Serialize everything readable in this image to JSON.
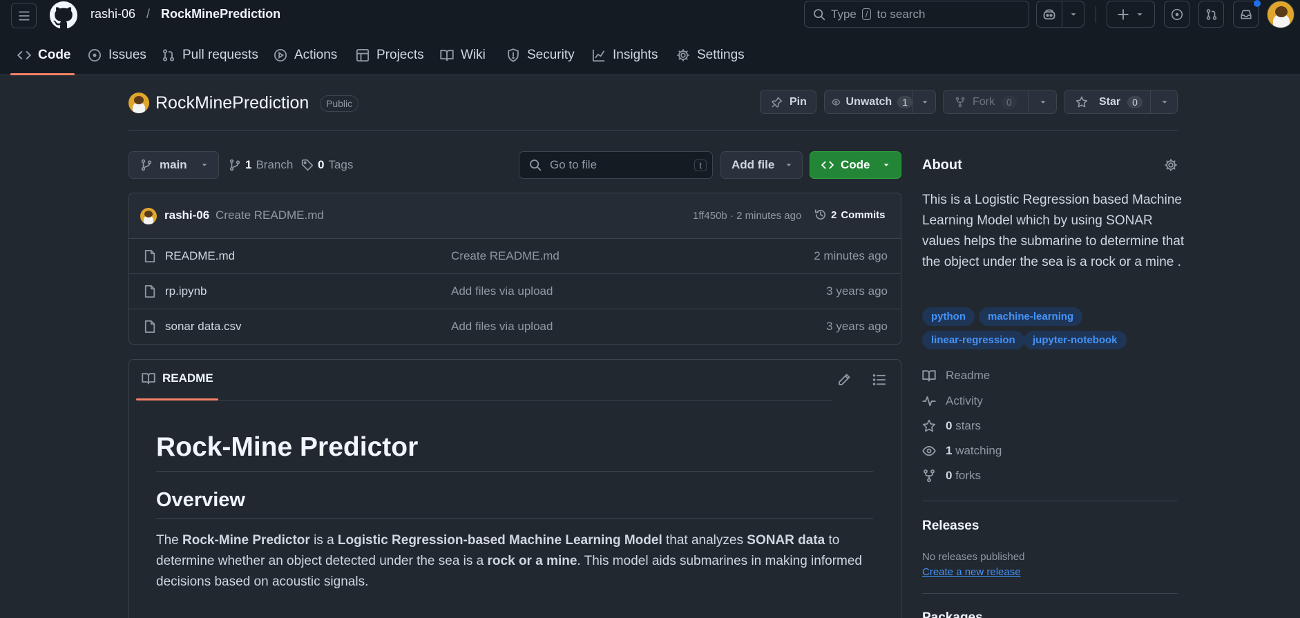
{
  "header": {
    "owner": "rashi-06",
    "separator": "/",
    "repo": "RockMinePrediction",
    "search_placeholder_parts": {
      "before": "Type",
      "key": "/",
      "after": "to search"
    }
  },
  "nav": {
    "tabs": [
      {
        "label": "Code",
        "icon": "code-icon",
        "active": true
      },
      {
        "label": "Issues",
        "icon": "issue-icon"
      },
      {
        "label": "Pull requests",
        "icon": "pull-request-icon"
      },
      {
        "label": "Actions",
        "icon": "play-icon"
      },
      {
        "label": "Projects",
        "icon": "table-icon"
      },
      {
        "label": "Wiki",
        "icon": "book-icon"
      },
      {
        "label": "Security",
        "icon": "shield-icon"
      },
      {
        "label": "Insights",
        "icon": "graph-icon"
      },
      {
        "label": "Settings",
        "icon": "gear-icon"
      }
    ]
  },
  "repo": {
    "name": "RockMinePrediction",
    "visibility": "Public",
    "pin_label": "Pin",
    "unwatch_label": "Unwatch",
    "unwatch_count": "1",
    "fork_label": "Fork",
    "fork_count": "0",
    "star_label": "Star",
    "star_count": "0"
  },
  "toolbar": {
    "branch": "main",
    "branch_count": "1",
    "branch_label": "Branch",
    "tags_count": "0",
    "tags_label": "Tags",
    "go_to_file": "Go to file",
    "go_to_file_key": "t",
    "add_file": "Add file",
    "code": "Code"
  },
  "commit": {
    "author": "rashi-06",
    "message": "Create README.md",
    "hash_time": "1ff450b · 2 minutes ago",
    "commits_count": "2",
    "commits_label": "Commits"
  },
  "files": [
    {
      "name": "README.md",
      "message": "Create README.md",
      "time": "2 minutes ago"
    },
    {
      "name": "rp.ipynb",
      "message": "Add files via upload",
      "time": "3 years ago"
    },
    {
      "name": "sonar data.csv",
      "message": "Add files via upload",
      "time": "3 years ago"
    }
  ],
  "readme": {
    "tab_label": "README",
    "title": "Rock-Mine Predictor",
    "section": "Overview",
    "para": {
      "t1": "The ",
      "b1": "Rock-Mine Predictor",
      "t2": " is a ",
      "b2": "Logistic Regression-based Machine Learning Model",
      "t3": " that analyzes ",
      "b3": "SONAR data",
      "t4": " to determine whether an object detected under the sea is a ",
      "b4": "rock or a mine",
      "t5": ". This model aids submarines in making informed decisions based on acoustic signals."
    }
  },
  "about": {
    "heading": "About",
    "description": "This is a Logistic Regression based Machine Learning Model which by using SONAR values helps the submarine to determine that the object under the sea is a rock or a mine .",
    "topics": [
      "python",
      "machine-learning",
      "linear-regression",
      "jupyter-notebook"
    ],
    "readme": "Readme",
    "activity": "Activity",
    "stars_count": "0",
    "stars_label": "stars",
    "watching_count": "1",
    "watching_label": "watching",
    "forks_count": "0",
    "forks_label": "forks"
  },
  "releases": {
    "heading": "Releases",
    "none": "No releases published",
    "create": "Create a new release"
  },
  "packages": {
    "heading": "Packages"
  },
  "colors": {
    "background": "#212830",
    "header": "#151b23",
    "accent_green": "#238636",
    "link": "#4493f8",
    "tab_underline": "#f78166",
    "notification_dot": "#1f6feb"
  }
}
